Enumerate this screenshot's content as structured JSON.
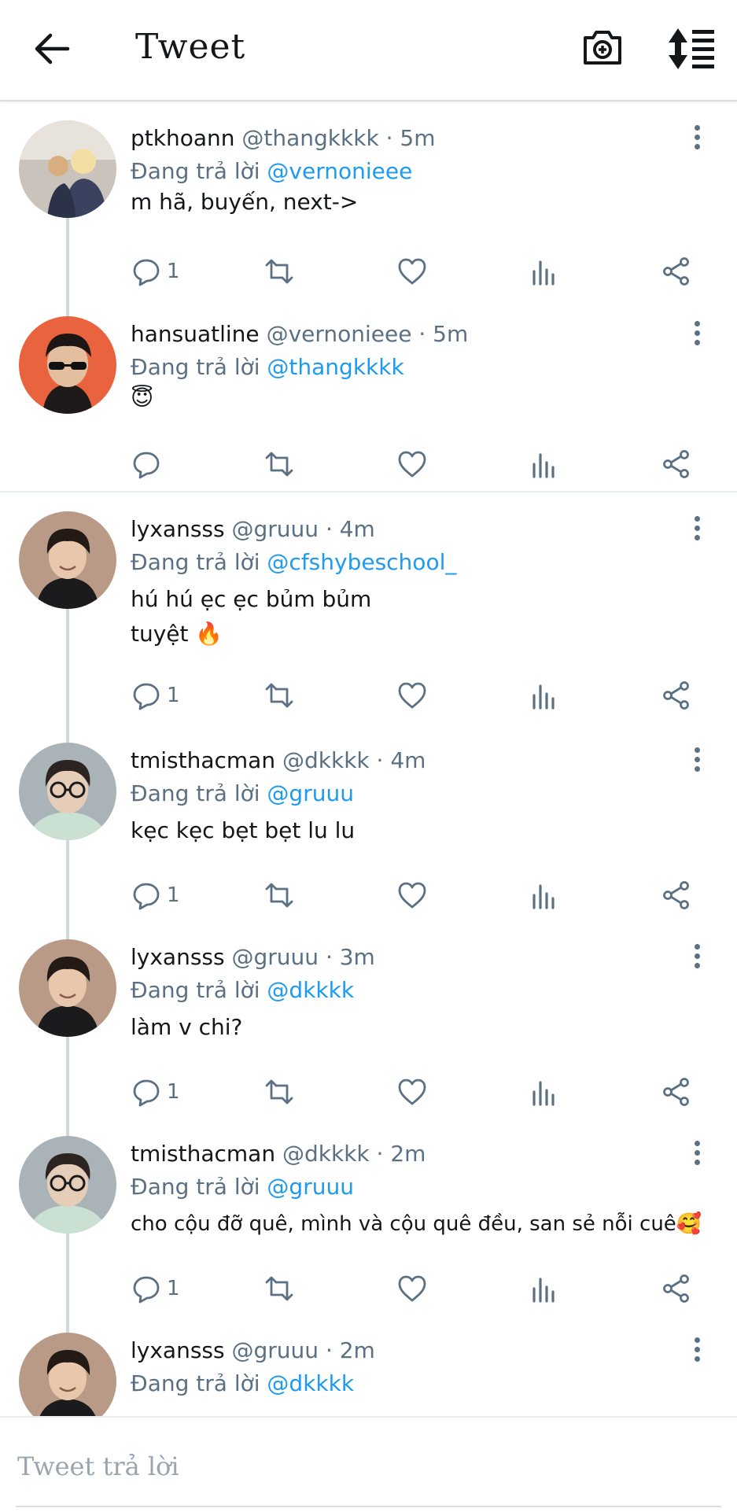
{
  "header": {
    "title": "Tweet",
    "back_icon": "arrow-left-icon",
    "camera_icon": "camera-plus-icon",
    "sort_icon": "sort-icon"
  },
  "colors": {
    "mention": "#1d9bf0",
    "secondary": "#5b7083",
    "thread_line": "#cfd9de"
  },
  "reply_prefix": "Đang trả lời",
  "tweets": [
    {
      "name": "ptkhoann",
      "handle": "@thangkkkk",
      "time": "· 5m",
      "reply_to": "@vernonieee",
      "lines": [
        "m hã, buyến, next->"
      ],
      "reply_count": "1"
    },
    {
      "name": "hansuatline",
      "handle": "@vernonieee",
      "time": "· 5m",
      "reply_to": "@thangkkkk",
      "lines": [
        "😇"
      ],
      "reply_count": ""
    },
    {
      "name": "lyxansss",
      "handle": "@gruuu",
      "time": "· 4m",
      "reply_to": "@cfshybeschool_",
      "lines": [
        "hú hú ẹc ẹc bủm bủm",
        "tuyệt 🔥"
      ],
      "reply_count": "1"
    },
    {
      "name": "tmisthacman",
      "handle": "@dkkkk",
      "time": "· 4m",
      "reply_to": "@gruuu",
      "lines": [
        "kẹc kẹc bẹt bẹt lu lu"
      ],
      "reply_count": "1"
    },
    {
      "name": "lyxansss",
      "handle": "@gruuu",
      "time": "· 3m",
      "reply_to": "@dkkkk",
      "lines": [
        "làm v chi?"
      ],
      "reply_count": "1"
    },
    {
      "name": "tmisthacman",
      "handle": "@dkkkk",
      "time": "· 2m",
      "reply_to": "@gruuu",
      "lines": [
        "cho cộu đỡ quê, mình và cộu quê đều, san sẻ nỗi cuê🥰"
      ],
      "reply_count": "1"
    },
    {
      "name": "lyxansss",
      "handle": "@gruuu",
      "time": "· 2m",
      "reply_to": "@dkkkk",
      "lines": [],
      "reply_count": ""
    }
  ],
  "composer": {
    "placeholder": "Tweet trả lời"
  }
}
